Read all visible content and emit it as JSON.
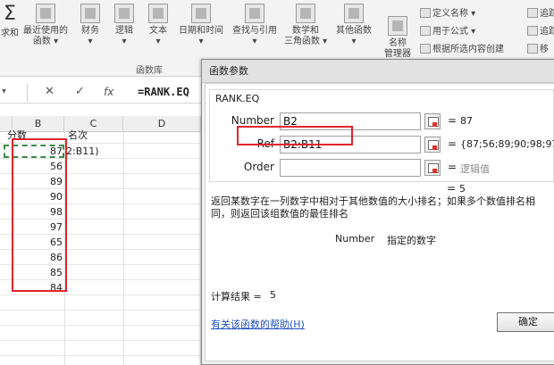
{
  "ribbon": {
    "sigma_partial": "Σ",
    "autosum_partial": "求和",
    "buttons": [
      {
        "label": "最近使用的",
        "sub": "函数 ▾"
      },
      {
        "label": "财务",
        "sub": "▾"
      },
      {
        "label": "逻辑",
        "sub": "▾"
      },
      {
        "label": "文本",
        "sub": "▾"
      },
      {
        "label": "日期和时间",
        "sub": "▾"
      },
      {
        "label": "查找与引用",
        "sub": "▾"
      },
      {
        "label": "数学和",
        "sub": "三角函数 ▾"
      },
      {
        "label": "其他函数",
        "sub": "▾"
      },
      {
        "label": "名称",
        "sub": "管理器"
      }
    ],
    "group_label": "函数库",
    "define_name": "定义名称 ▾",
    "use_in_formula": "用于公式 ▾",
    "create_from_selection": "根据所选内容创建",
    "trace1": "追踪",
    "trace2": "追踪",
    "remove": "移"
  },
  "formula_bar": {
    "cancel": "✕",
    "enter": "✓",
    "fx": "fx",
    "formula": "=RANK.EQ"
  },
  "sheet": {
    "col_b": "B",
    "col_c": "C",
    "col_d": "D",
    "b1": "分数",
    "c1": "名次",
    "c2": "2:B11)",
    "scores": [
      "87",
      "56",
      "89",
      "90",
      "98",
      "97",
      "65",
      "86",
      "85",
      "84"
    ]
  },
  "dialog": {
    "title": "函数参数",
    "function_name": "RANK.EQ",
    "args": [
      {
        "label": "Number",
        "value": "B2",
        "result": "87"
      },
      {
        "label": "Ref",
        "value": "B2:B11",
        "result": "{87;56;89;90;98;97;65"
      },
      {
        "label": "Order",
        "value": "",
        "result": "逻辑值"
      }
    ],
    "eq_sign": "=",
    "overall_result": "5",
    "description": "返回某数字在一列数字中相对于其他数值的大小排名；如果多个数值排名相同，则返回该组数值的最佳排名",
    "arg_help_name": "Number",
    "arg_help_text": "指定的数字",
    "calc_label": "计算结果 =",
    "calc_value": "5",
    "help_link": "有关该函数的帮助(H)",
    "ok": "确定"
  }
}
